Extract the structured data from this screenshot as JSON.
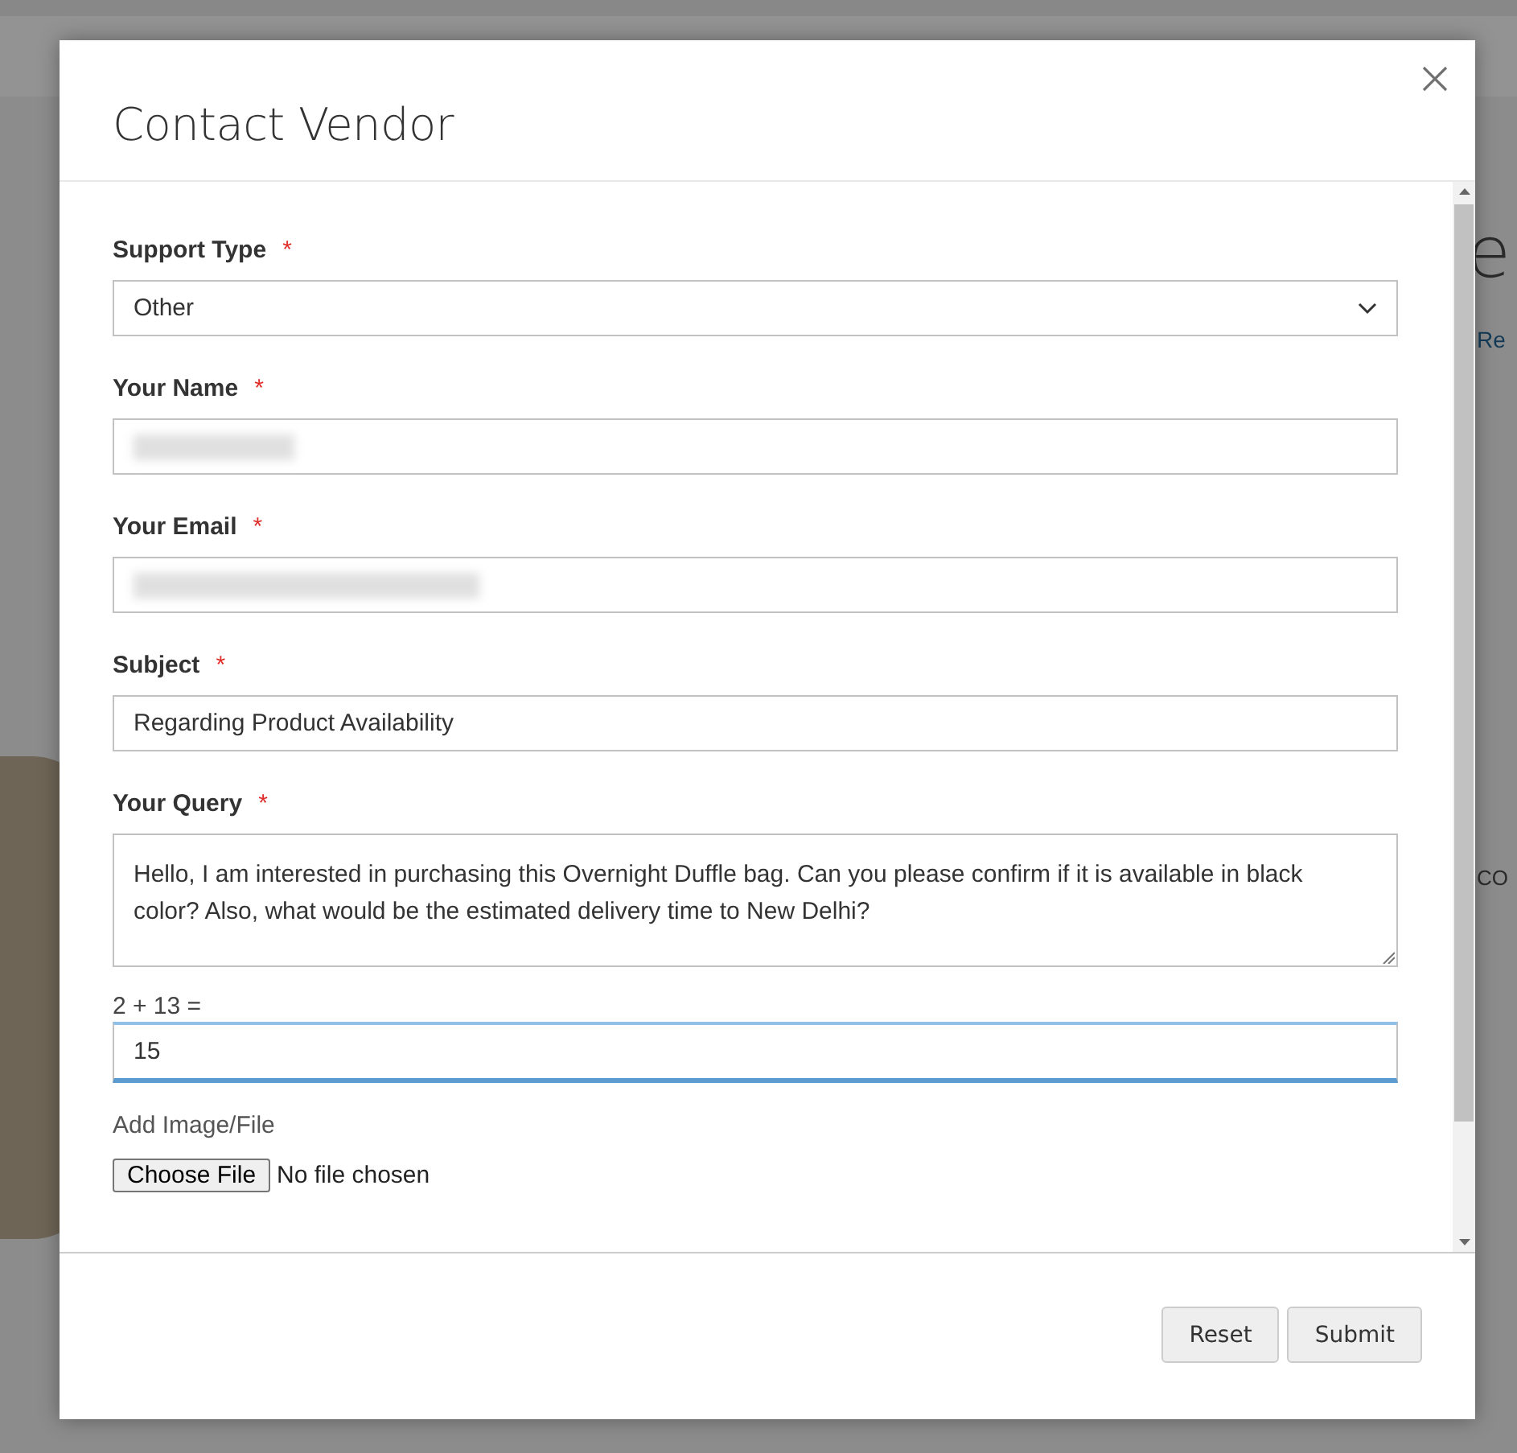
{
  "background": {
    "heading_fragment": "e",
    "link_fragment": "Re",
    "tab_fragment": "CO"
  },
  "modal": {
    "title": "Contact Vendor",
    "fields": [
      {
        "kind": "select",
        "label": "Support Type",
        "required_mark": "*",
        "value": "Other"
      },
      {
        "kind": "redacted",
        "label": "Your Name",
        "required_mark": "*"
      },
      {
        "kind": "redacted",
        "label": "Your Email",
        "required_mark": "*"
      },
      {
        "kind": "text",
        "label": "Subject",
        "required_mark": "*",
        "value": "Regarding Product Availability"
      },
      {
        "kind": "textarea",
        "label": "Your Query",
        "required_mark": "*",
        "value": "Hello, I am interested in purchasing this Overnight Duffle bag. Can you please confirm if it is available in black color? Also, what would be the estimated delivery time to New Delhi?"
      },
      {
        "kind": "captcha",
        "label": "2 + 13 =",
        "value": "15",
        "focused": true
      },
      {
        "kind": "file",
        "label": "Add Image/File",
        "button": "Choose File",
        "status": "No file chosen"
      }
    ],
    "buttons": [
      "Reset",
      "Submit"
    ]
  }
}
